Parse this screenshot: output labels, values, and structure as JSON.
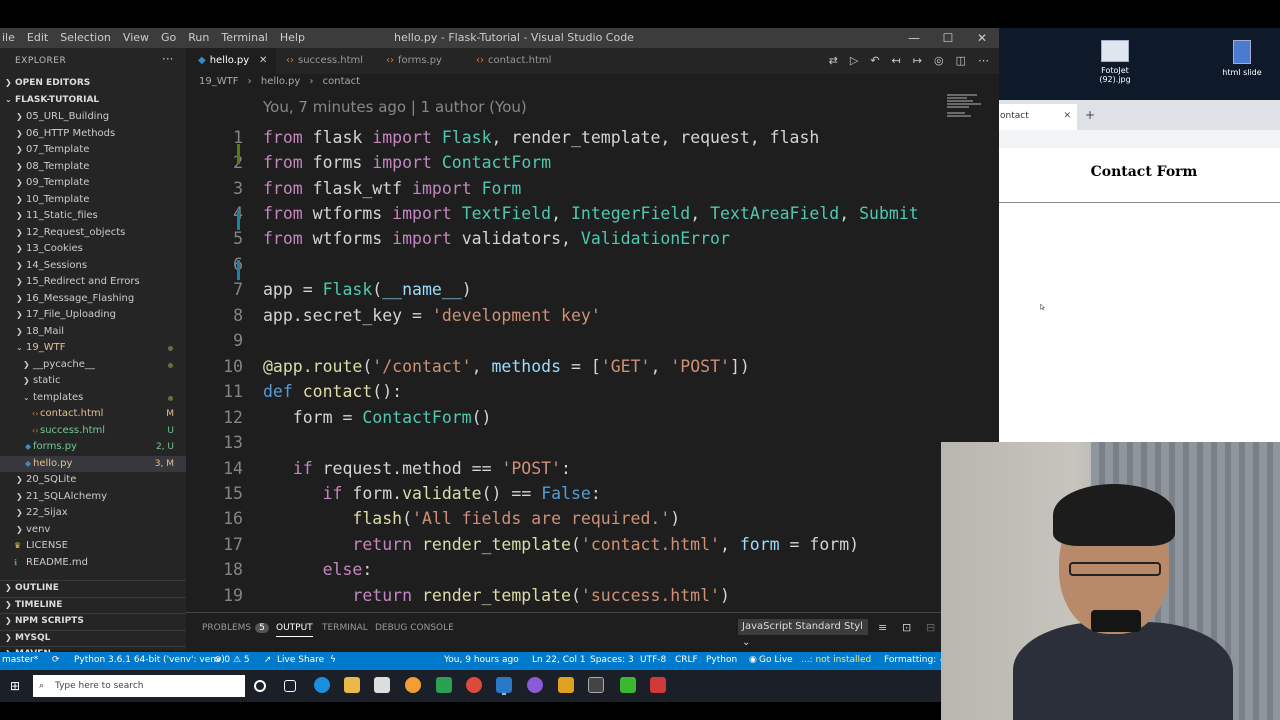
{
  "vscode": {
    "menu": [
      "ile",
      "Edit",
      "Selection",
      "View",
      "Go",
      "Run",
      "Terminal",
      "Help"
    ],
    "window_title": "hello.py - Flask-Tutorial - Visual Studio Code",
    "controls": [
      "—",
      "☐",
      "✕"
    ]
  },
  "sidebar": {
    "header": "EXPLORER",
    "dots": "···",
    "open_editors": "OPEN EDITORS",
    "project": "FLASK-TUTORIAL",
    "items": [
      {
        "label": "05_URL_Building",
        "chev": "❯"
      },
      {
        "label": "06_HTTP Methods",
        "chev": "❯"
      },
      {
        "label": "07_Template",
        "chev": "❯"
      },
      {
        "label": "08_Template",
        "chev": "❯"
      },
      {
        "label": "09_Template",
        "chev": "❯"
      },
      {
        "label": "10_Template",
        "chev": "❯"
      },
      {
        "label": "11_Static_files",
        "chev": "❯"
      },
      {
        "label": "12_Request_objects",
        "chev": "❯"
      },
      {
        "label": "13_Cookies",
        "chev": "❯"
      },
      {
        "label": "14_Sessions",
        "chev": "❯"
      },
      {
        "label": "15_Redirect and Errors",
        "chev": "❯"
      },
      {
        "label": "16_Message_Flashing",
        "chev": "❯"
      },
      {
        "label": "17_File_Uploading",
        "chev": "❯"
      },
      {
        "label": "18_Mail",
        "chev": "❯"
      },
      {
        "label": "19_WTF",
        "chev": "⌄"
      },
      {
        "label": "__pycache__",
        "chev": "❯"
      },
      {
        "label": "static",
        "chev": "❯"
      },
      {
        "label": "templates",
        "chev": "⌄"
      },
      {
        "label": "contact.html",
        "status": "M"
      },
      {
        "label": "success.html",
        "status": "U"
      },
      {
        "label": "forms.py",
        "status": "2, U"
      },
      {
        "label": "hello.py",
        "status": "3, M"
      },
      {
        "label": "20_SQLite",
        "chev": "❯"
      },
      {
        "label": "21_SQLAlchemy",
        "chev": "❯"
      },
      {
        "label": "22_Sijax",
        "chev": "❯"
      },
      {
        "label": "venv",
        "chev": "❯"
      },
      {
        "label": "LICENSE"
      },
      {
        "label": "README.md"
      }
    ],
    "bottom_sections": [
      "OUTLINE",
      "TIMELINE",
      "NPM SCRIPTS",
      "MYSQL",
      "MAVEN"
    ]
  },
  "tabs": [
    {
      "label": "hello.py",
      "close": "✕"
    },
    {
      "label": "success.html"
    },
    {
      "label": "forms.py"
    },
    {
      "label": "contact.html"
    }
  ],
  "breadcrumb": {
    "folder": "19_WTF",
    "sep": "›",
    "file": "hello.py",
    "symbol": "contact"
  },
  "codelens": "You, 7 minutes ago | 1 author (You)",
  "line_numbers": [
    "1",
    "2",
    "3",
    "4",
    "5",
    "6",
    "7",
    "8",
    "9",
    "10",
    "11",
    "12",
    "13",
    "14",
    "15",
    "16",
    "17",
    "18",
    "19"
  ],
  "panel": {
    "tabs": [
      "PROBLEMS",
      "OUTPUT",
      "TERMINAL",
      "DEBUG CONSOLE"
    ],
    "problems_count": "5",
    "select": "JavaScript Standard Styl"
  },
  "statusbar": {
    "branch": "master*",
    "python": "Python 3.6.1 64-bit ('venv': venv)",
    "errors": "⊗ 0 ⚠ 5",
    "liveshare": "Live Share",
    "blame": "You, 9 hours ago",
    "position": "Ln 22, Col 1",
    "spaces": "Spaces: 3",
    "encoding": "UTF-8",
    "eol": "CRLF",
    "language": "Python",
    "golive": "Go Live",
    "notinstalled": "...: not installed",
    "formatting": "Formatting: ✓"
  },
  "desktop": {
    "icons": [
      "FotoJet (92).jpg",
      "html slide"
    ]
  },
  "browser": {
    "tab_label": "ontact",
    "tab_close": "✕",
    "new_tab": "+",
    "page_title": "Contact Form"
  },
  "taskbar": {
    "search_placeholder": "Type here to search"
  },
  "colors": {
    "accent": "#007acc",
    "editor_bg": "#1e1e1e",
    "sidebar_bg": "#252526"
  }
}
